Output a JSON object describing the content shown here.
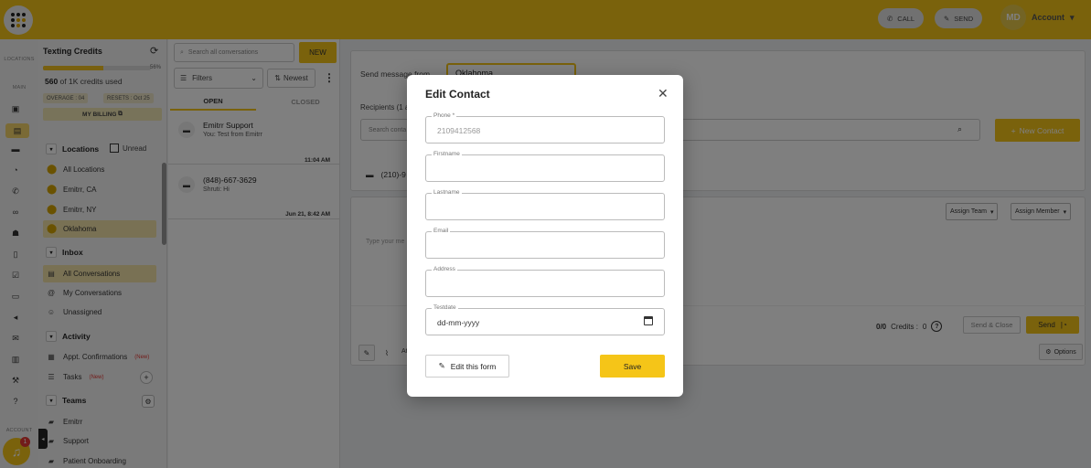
{
  "topbar": {
    "call_label": "CALL",
    "send_label": "SEND",
    "avatar_initials": "MD",
    "account_label": "Account"
  },
  "rail": {
    "locations_label": "LOCATIONS",
    "main_label": "MAIN",
    "account_label": "ACCOUNT",
    "notification_count": "1"
  },
  "nav": {
    "credits_title": "Texting Credits",
    "credits_pct_text": "56%",
    "credits_fraction": 0.56,
    "credits_used_number": "560",
    "credits_used_rest": " of 1K credits used",
    "overage": "OVERAGE : 04",
    "resets": "RESETS : Oct 25",
    "billing": "MY BILLING",
    "locations_header": "Locations",
    "unread_label": "Unread",
    "locations": [
      "All Locations",
      "Emitrr, CA",
      "Emitrr, NY",
      "Oklahoma"
    ],
    "inbox_header": "Inbox",
    "inbox": [
      "All Conversations",
      "My Conversations",
      "Unassigned"
    ],
    "activity_header": "Activity",
    "activity_appt": "Appt. Confirmations",
    "activity_tasks": "Tasks",
    "new_tag": "(New)",
    "teams_header": "Teams",
    "teams": [
      "Emitrr",
      "Support",
      "Patient Onboarding"
    ]
  },
  "convlist": {
    "search_placeholder": "Search all conversations",
    "new_label": "NEW",
    "filters_label": "Filters",
    "newest_label": "Newest",
    "tab_open": "OPEN",
    "tab_closed": "CLOSED",
    "conversations": [
      {
        "name": "Emitrr Support",
        "preview": "You: Test from Emitrr",
        "time": "11:04 AM"
      },
      {
        "name": "(848)-667-3629",
        "preview": "Shruti: Hi",
        "time": "Jun 21, 8:42 AM"
      }
    ]
  },
  "main": {
    "send_from_label": "Send message from",
    "send_from_value": "Oklahoma",
    "recipients_label": "Recipients (1 a",
    "search_placeholder": "Search conta",
    "new_contact_label": "New Contact",
    "recipient_number": "(210)-9",
    "assign_team": "Assign Team",
    "assign_member": "Assign Member",
    "type_placeholder": "Type your me",
    "counter": "0/0",
    "credits_label": "Credits :",
    "credits_value": "0",
    "send_close": "Send & Close",
    "send": "Send",
    "attach_label": "Atta",
    "options": "Options"
  },
  "modal": {
    "title": "Edit Contact",
    "fields": [
      {
        "label": "Phone *",
        "value": "2109412568"
      },
      {
        "label": "Firstname",
        "value": ""
      },
      {
        "label": "Lastname",
        "value": ""
      },
      {
        "label": "Email",
        "value": ""
      },
      {
        "label": "Address",
        "value": ""
      },
      {
        "label": "Testdate",
        "value": "dd-mm-yyyy"
      }
    ],
    "edit_form_label": "Edit this form",
    "save_label": "Save"
  },
  "colors": {
    "brand": "#f5c518",
    "alert": "#e53935"
  }
}
